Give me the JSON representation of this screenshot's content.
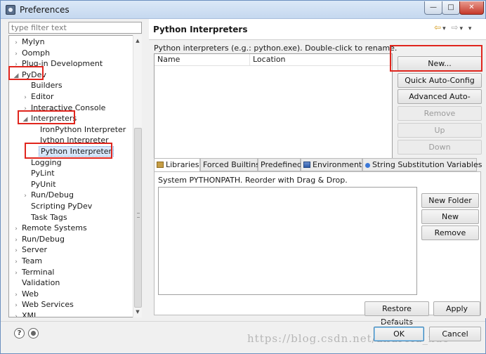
{
  "window": {
    "title": "Preferences",
    "controls": {
      "minimize": "—",
      "maximize": "□",
      "close": "✕"
    }
  },
  "filter": {
    "placeholder": "type filter text"
  },
  "tree": [
    {
      "label": "Mylyn",
      "arrow": "›",
      "level": 1
    },
    {
      "label": "Oomph",
      "arrow": "›",
      "level": 1
    },
    {
      "label": "Plug-in Development",
      "arrow": "›",
      "level": 1
    },
    {
      "label": "PyDev",
      "arrow": "◢",
      "level": 1
    },
    {
      "label": "Builders",
      "arrow": "",
      "level": 2
    },
    {
      "label": "Editor",
      "arrow": "›",
      "level": 2
    },
    {
      "label": "Interactive Console",
      "arrow": "›",
      "level": 2
    },
    {
      "label": "Interpreters",
      "arrow": "◢",
      "level": 2
    },
    {
      "label": "IronPython Interpreter",
      "arrow": "",
      "level": 3
    },
    {
      "label": "Jython Interpreter",
      "arrow": "",
      "level": 3
    },
    {
      "label": "Python Interpreter",
      "arrow": "",
      "level": 3,
      "selected": true
    },
    {
      "label": "Logging",
      "arrow": "",
      "level": 2
    },
    {
      "label": "PyLint",
      "arrow": "",
      "level": 2
    },
    {
      "label": "PyUnit",
      "arrow": "",
      "level": 2
    },
    {
      "label": "Run/Debug",
      "arrow": "›",
      "level": 2
    },
    {
      "label": "Scripting PyDev",
      "arrow": "",
      "level": 2
    },
    {
      "label": "Task Tags",
      "arrow": "",
      "level": 2
    },
    {
      "label": "Remote Systems",
      "arrow": "›",
      "level": 1
    },
    {
      "label": "Run/Debug",
      "arrow": "›",
      "level": 1
    },
    {
      "label": "Server",
      "arrow": "›",
      "level": 1
    },
    {
      "label": "Team",
      "arrow": "›",
      "level": 1
    },
    {
      "label": "Terminal",
      "arrow": "›",
      "level": 1
    },
    {
      "label": "Validation",
      "arrow": "",
      "level": 1
    },
    {
      "label": "Web",
      "arrow": "›",
      "level": 1
    },
    {
      "label": "Web Services",
      "arrow": "›",
      "level": 1
    },
    {
      "label": "XML",
      "arrow": "›",
      "level": 1
    }
  ],
  "page": {
    "title": "Python Interpreters",
    "nav": {
      "back": "⇦",
      "forward": "⇨",
      "menu": "▾"
    },
    "description": "Python interpreters (e.g.: python.exe).   Double-click to rename.",
    "columns": {
      "name": "Name",
      "location": "Location"
    },
    "buttons": {
      "new": "New...",
      "quick": "Quick Auto-Config",
      "advanced": "Advanced Auto-Config",
      "remove": "Remove",
      "up": "Up",
      "down": "Down"
    },
    "tabs": {
      "libraries": "Libraries",
      "forced": "Forced Builtins",
      "predefined": "Predefined",
      "environment": "Environment",
      "substitution": "String Substitution Variables"
    },
    "libraries": {
      "system_path": "System PYTHONPATH.   Reorder with Drag & Drop.",
      "new_folder": "New Folder",
      "new_egg": "New Egg/Zip(s)",
      "remove": "Remove"
    },
    "restore_defaults": "Restore Defaults",
    "apply": "Apply"
  },
  "footer": {
    "help": "?",
    "ok": "OK",
    "cancel": "Cancel",
    "watermark": "https://blog.csdn.net/android_xue"
  },
  "colors": {
    "highlight_box": "#e0261e",
    "selection": "#d9e8fb"
  }
}
